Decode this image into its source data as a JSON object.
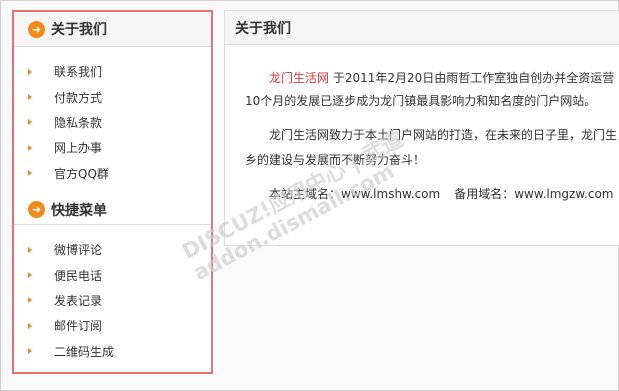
{
  "sidebar": {
    "about_title": "关于我们",
    "about_items": [
      "联系我们",
      "付款方式",
      "隐私条款",
      "网上办事",
      "官方QQ群"
    ],
    "quick_title": "快捷菜单",
    "quick_items": [
      "微博评论",
      "便民电话",
      "发表记录",
      "邮件订阅",
      "二维码生成"
    ]
  },
  "main": {
    "title": "关于我们",
    "brand_name": "龙门生活网",
    "p1_rest": " 于2011年2月20日由雨哲工作室独自创办并全资运营",
    "p1_line2": "10个月的发展已逐步成为龙门镇最具影响力和知名度的门户网站。",
    "p2_line1": "龙门生活网致力于本土门户网站的打造，在未来的日子里，龙门生",
    "p2_line2": "乡的建设与发展而不断努力奋斗！",
    "domain_label": "本站主域名：",
    "domain_value": "www.lmshw.com",
    "alt_domain_label": "备用域名：",
    "alt_domain_value": "www.lmgzw.com"
  },
  "watermark": {
    "line1": "DISCUZ!应用中心 | 武道",
    "line2": "addon.dismall.com"
  },
  "colors": {
    "accent": "#f08b1a",
    "highlight_border": "#e57373",
    "brand_link": "#d9363e"
  }
}
